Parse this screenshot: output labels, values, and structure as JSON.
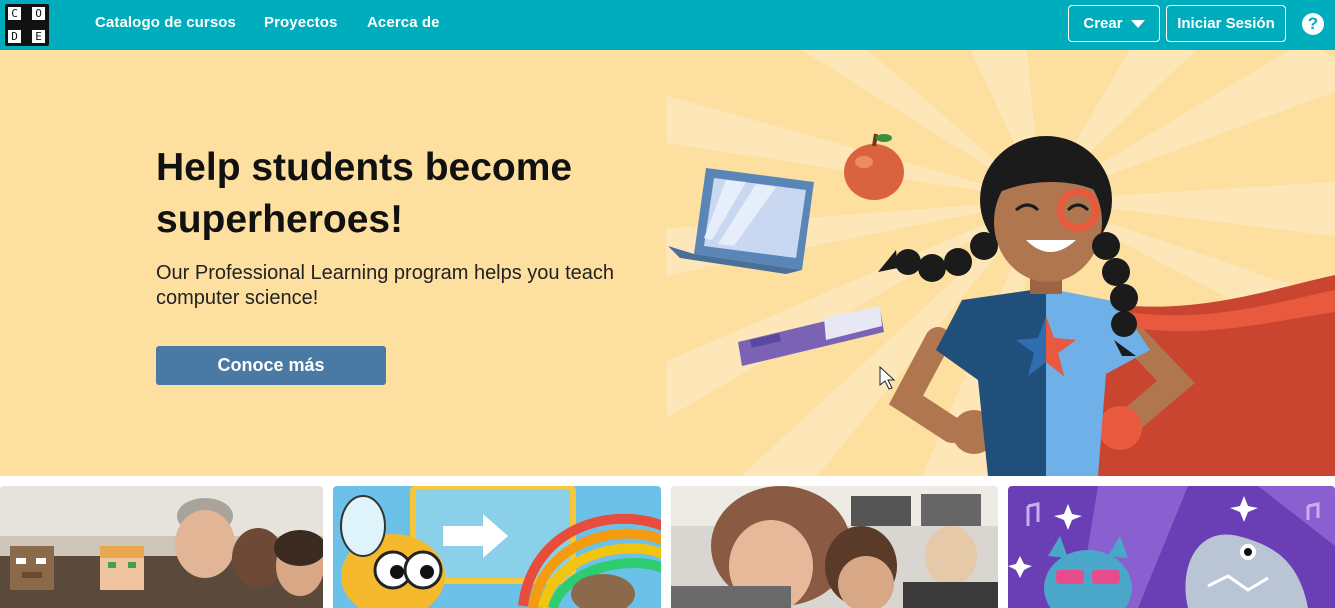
{
  "header": {
    "logo_letters": [
      "C",
      "O",
      "D",
      "E"
    ],
    "nav": [
      "Catalogo de cursos",
      "Proyectos",
      "Acerca de"
    ],
    "create_label": "Crear",
    "signin_label": "Iniciar Sesión",
    "help_glyph": "?"
  },
  "hero": {
    "title": "Help students become superheroes!",
    "subtitle": "Our Professional Learning program helps you teach computer science!",
    "cta_label": "Conoce más"
  },
  "colors": {
    "brand_teal": "#00adbc",
    "hero_bg": "#fddfa0",
    "cta_blue": "#4a7aa3"
  },
  "cards": [
    {
      "name": "minecraft-students-card"
    },
    {
      "name": "bee-game-card"
    },
    {
      "name": "teacher-classroom-card"
    },
    {
      "name": "dance-party-card"
    }
  ]
}
